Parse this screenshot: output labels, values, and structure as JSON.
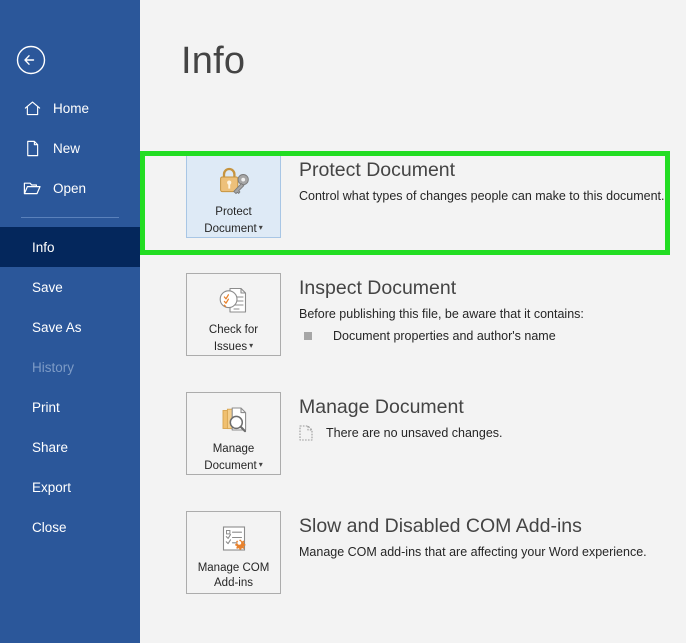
{
  "sidebar": {
    "back_label": "Back",
    "back_icon": "back-arrow-circle-icon",
    "items": [
      {
        "label": "Home",
        "icon": "home-icon",
        "state": "normal",
        "has_icon": true
      },
      {
        "label": "New",
        "icon": "page-icon",
        "state": "normal",
        "has_icon": true
      },
      {
        "label": "Open",
        "icon": "folder-icon",
        "state": "normal",
        "has_icon": true
      },
      {
        "label": "Info",
        "icon": "",
        "state": "selected",
        "has_icon": false
      },
      {
        "label": "Save",
        "icon": "",
        "state": "normal",
        "has_icon": false
      },
      {
        "label": "Save As",
        "icon": "",
        "state": "normal",
        "has_icon": false
      },
      {
        "label": "History",
        "icon": "",
        "state": "disabled",
        "has_icon": false
      },
      {
        "label": "Print",
        "icon": "",
        "state": "normal",
        "has_icon": false
      },
      {
        "label": "Share",
        "icon": "",
        "state": "normal",
        "has_icon": false
      },
      {
        "label": "Export",
        "icon": "",
        "state": "normal",
        "has_icon": false
      },
      {
        "label": "Close",
        "icon": "",
        "state": "normal",
        "has_icon": false
      }
    ]
  },
  "main": {
    "title": "Info",
    "sections": [
      {
        "id": "protect-document",
        "button_line1": "Protect",
        "button_line2": "Document",
        "button_caret": true,
        "button_icon": "lock-and-key-icon",
        "button_highlighted": true,
        "heading": "Protect Document",
        "description": "Control what types of changes people can make to this document.",
        "detail_text": "",
        "detail_icon": ""
      },
      {
        "id": "inspect-document",
        "button_line1": "Check for",
        "button_line2": "Issues",
        "button_caret": true,
        "button_icon": "document-inspect-icon",
        "button_highlighted": false,
        "heading": "Inspect Document",
        "description": "Before publishing this file, be aware that it contains:",
        "detail_text": "Document properties and author's name",
        "detail_icon": "square-bullet-icon"
      },
      {
        "id": "manage-document",
        "button_line1": "Manage",
        "button_line2": "Document",
        "button_caret": true,
        "button_icon": "document-versions-search-icon",
        "button_highlighted": false,
        "heading": "Manage Document",
        "description": "",
        "detail_text": "There are no unsaved changes.",
        "detail_icon": "dotted-document-icon"
      },
      {
        "id": "com-add-ins",
        "button_line1": "Manage COM",
        "button_line2": "Add-ins",
        "button_caret": false,
        "button_icon": "checklist-gear-icon",
        "button_highlighted": false,
        "heading": "Slow and Disabled COM Add-ins",
        "description": "Manage COM add-ins that are affecting your Word experience.",
        "detail_text": "",
        "detail_icon": ""
      }
    ]
  },
  "annotation": {
    "highlight_target": "protect-document",
    "highlight_color": "#22dd22"
  },
  "colors": {
    "sidebar_bg": "#2b579a",
    "sidebar_selected_bg": "#04275c",
    "main_bg": "#f3f3f3",
    "accent_button_bg": "#deeaf6",
    "heading_text": "#444444",
    "body_text": "#262626"
  }
}
